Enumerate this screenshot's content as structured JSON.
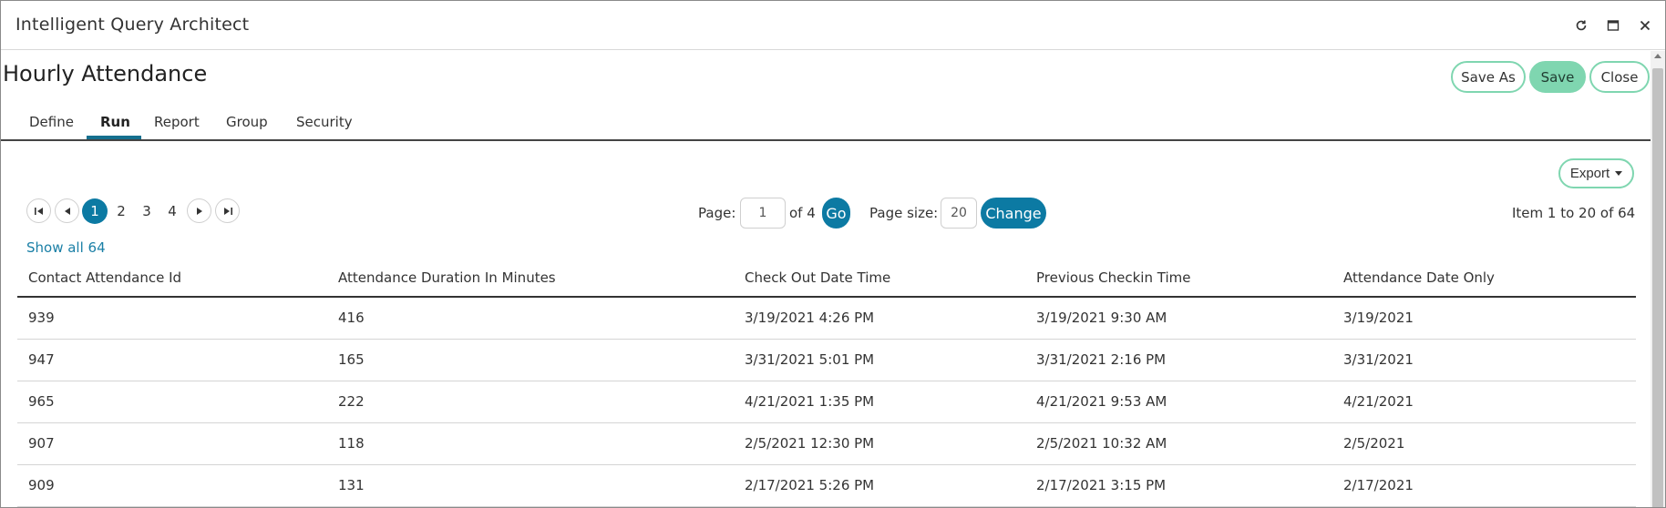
{
  "window": {
    "title": "Intelligent Query Architect",
    "controls": [
      "refresh-icon",
      "maximize-icon",
      "close-icon"
    ]
  },
  "header": {
    "title": "Hourly Attendance",
    "save_as_label": "Save As",
    "save_label": "Save",
    "close_label": "Close"
  },
  "tabs": [
    {
      "label": "Define",
      "active": false
    },
    {
      "label": "Run",
      "active": true
    },
    {
      "label": "Report",
      "active": false
    },
    {
      "label": "Group",
      "active": false
    },
    {
      "label": "Security",
      "active": false
    }
  ],
  "export": {
    "label": "Export"
  },
  "pager": {
    "pages": [
      "1",
      "2",
      "3",
      "4"
    ],
    "current": "1",
    "page_label": "Page:",
    "page_value": "1",
    "of_label": "of 4",
    "go_label": "Go",
    "size_label": "Page size:",
    "size_value": "20",
    "change_label": "Change",
    "items_label": "Item 1 to 20 of 64",
    "show_all": "Show all 64"
  },
  "table": {
    "columns": [
      "Contact Attendance Id",
      "Attendance Duration In Minutes",
      "Check Out Date Time",
      "Previous Checkin Time",
      "Attendance Date Only"
    ],
    "rows": [
      [
        "939",
        "416",
        "3/19/2021 4:26 PM",
        "3/19/2021 9:30 AM",
        "3/19/2021"
      ],
      [
        "947",
        "165",
        "3/31/2021 5:01 PM",
        "3/31/2021 2:16 PM",
        "3/31/2021"
      ],
      [
        "965",
        "222",
        "4/21/2021 1:35 PM",
        "4/21/2021 9:53 AM",
        "4/21/2021"
      ],
      [
        "907",
        "118",
        "2/5/2021 12:30 PM",
        "2/5/2021 10:32 AM",
        "2/5/2021"
      ],
      [
        "909",
        "131",
        "2/17/2021 5:26 PM",
        "2/17/2021 3:15 PM",
        "2/17/2021"
      ]
    ]
  },
  "colors": {
    "accent_green": "#7fd6b0",
    "accent_blue": "#0c7aa3",
    "link_blue": "#1a7fa6"
  }
}
